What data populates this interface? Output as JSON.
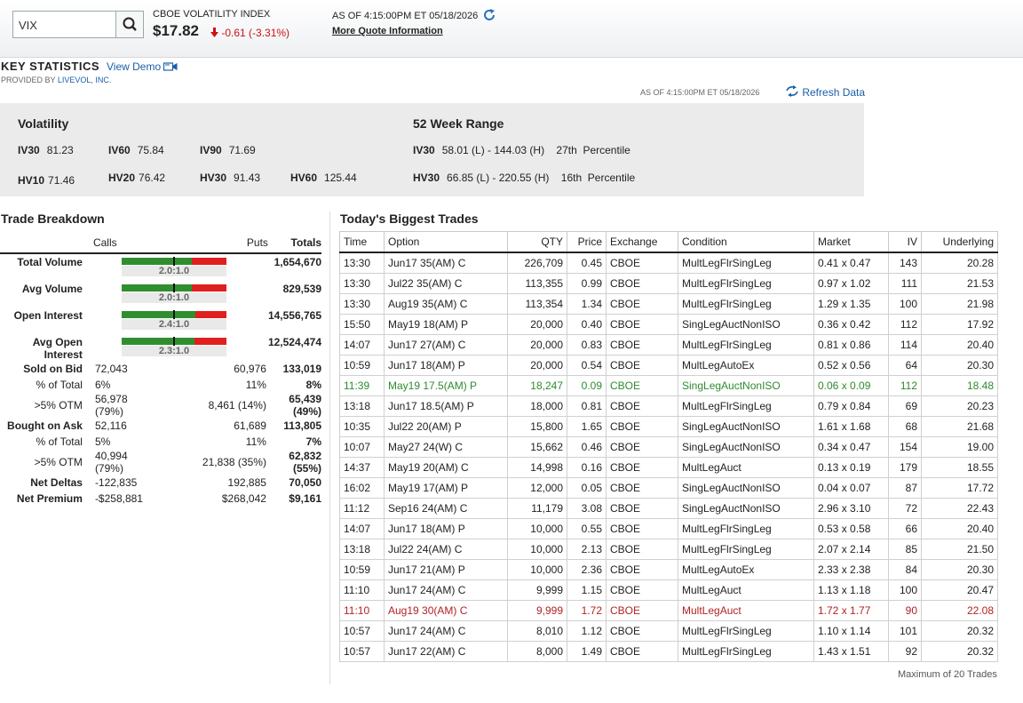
{
  "quote": {
    "symbol_value": "VIX",
    "name": "CBOE VOLATILITY INDEX",
    "price": "$17.82",
    "change": "-0.61 (-3.31%)",
    "asof": "AS OF 4:15:00PM ET 05/18/2026",
    "more_info": "More Quote Information"
  },
  "key_stats": {
    "title": "KEY STATISTICS",
    "view_demo": "View Demo",
    "provided_prefix": "PROVIDED BY",
    "provider": "LIVEVOL, INC.",
    "asof": "AS OF 4:15:00PM ET 05/18/2026",
    "refresh_label": "Refresh Data"
  },
  "volatility": {
    "title": "Volatility",
    "items": [
      {
        "label": "IV30",
        "value": "81.23"
      },
      {
        "label": "IV60",
        "value": "75.84"
      },
      {
        "label": "IV90",
        "value": "71.69"
      },
      {
        "label": "HV10",
        "value": "71.46"
      },
      {
        "label": "HV20",
        "value": "76.42"
      },
      {
        "label": "HV30",
        "value": "91.43"
      },
      {
        "label": "HV60",
        "value": "125.44"
      }
    ]
  },
  "week52": {
    "title": "52 Week Range",
    "rows": [
      {
        "label": "IV30",
        "range": "58.01 (L) - 144.03 (H)",
        "pct": "27th",
        "pct_label": "Percentile"
      },
      {
        "label": "HV30",
        "range": "66.85 (L) - 220.55 (H)",
        "pct": "16th",
        "pct_label": "Percentile"
      }
    ]
  },
  "trade_breakdown": {
    "title": "Trade Breakdown",
    "headers": {
      "calls": "Calls",
      "puts": "Puts",
      "totals": "Totals"
    },
    "ratio_rows": [
      {
        "label": "Total Volume",
        "ratio": "2.0:1.0",
        "call_fraction": 0.667,
        "total": "1,654,670"
      },
      {
        "label": "Avg Volume",
        "ratio": "2.0:1.0",
        "call_fraction": 0.667,
        "total": "829,539"
      },
      {
        "label": "Open Interest",
        "ratio": "2.4:1.0",
        "call_fraction": 0.706,
        "total": "14,556,765"
      },
      {
        "label": "Avg Open Interest",
        "ratio": "2.3:1.0",
        "call_fraction": 0.697,
        "total": "12,524,474"
      }
    ],
    "rows": [
      {
        "label": "Sold on Bid",
        "calls": "72,043",
        "puts": "60,976",
        "total": "133,019",
        "bold": true
      },
      {
        "label": "% of Total",
        "calls": "6%",
        "puts": "11%",
        "total": "8%",
        "bold": false
      },
      {
        "label": ">5% OTM",
        "calls": "56,978 (79%)",
        "puts": "8,461 (14%)",
        "total": "65,439 (49%)",
        "bold": false
      },
      {
        "label": "Bought on Ask",
        "calls": "52,116",
        "puts": "61,689",
        "total": "113,805",
        "bold": true
      },
      {
        "label": "% of Total",
        "calls": "5%",
        "puts": "11%",
        "total": "7%",
        "bold": false
      },
      {
        "label": ">5% OTM",
        "calls": "40,994 (79%)",
        "puts": "21,838 (35%)",
        "total": "62,832 (55%)",
        "bold": false
      },
      {
        "label": "Net Deltas",
        "calls": "-122,835",
        "puts": "192,885",
        "total": "70,050",
        "bold": true
      },
      {
        "label": "Net Premium",
        "calls": "-$258,881",
        "puts": "$268,042",
        "total": "$9,161",
        "bold": true
      }
    ]
  },
  "biggest_trades": {
    "title": "Today's Biggest Trades",
    "headers": [
      "Time",
      "Option",
      "QTY",
      "Price",
      "Exchange",
      "Condition",
      "Market",
      "IV",
      "Underlying"
    ],
    "rows": [
      [
        "13:30",
        "Jun17 35(AM) C",
        "226,709",
        "0.45",
        "CBOE",
        "MultLegFlrSingLeg",
        "0.41 x 0.47",
        "143",
        "20.28",
        ""
      ],
      [
        "13:30",
        "Jul22 35(AM) C",
        "113,355",
        "0.99",
        "CBOE",
        "MultLegFlrSingLeg",
        "0.97 x 1.02",
        "111",
        "21.53",
        ""
      ],
      [
        "13:30",
        "Aug19 35(AM) C",
        "113,354",
        "1.34",
        "CBOE",
        "MultLegFlrSingLeg",
        "1.29 x 1.35",
        "100",
        "21.98",
        ""
      ],
      [
        "15:50",
        "May19 18(AM) P",
        "20,000",
        "0.40",
        "CBOE",
        "SingLegAuctNonISO",
        "0.36 x 0.42",
        "112",
        "17.92",
        ""
      ],
      [
        "14:07",
        "Jun17 27(AM) C",
        "20,000",
        "0.83",
        "CBOE",
        "MultLegFlrSingLeg",
        "0.81 x 0.86",
        "114",
        "20.40",
        ""
      ],
      [
        "10:59",
        "Jun17 18(AM) P",
        "20,000",
        "0.54",
        "CBOE",
        "MultLegAutoEx",
        "0.52 x 0.56",
        "64",
        "20.30",
        ""
      ],
      [
        "11:39",
        "May19 17.5(AM) P",
        "18,247",
        "0.09",
        "CBOE",
        "SingLegAuctNonISO",
        "0.06 x 0.09",
        "112",
        "18.48",
        "#2e8b2e"
      ],
      [
        "13:18",
        "Jun17 18.5(AM) P",
        "18,000",
        "0.81",
        "CBOE",
        "MultLegFlrSingLeg",
        "0.79 x 0.84",
        "69",
        "20.23",
        ""
      ],
      [
        "10:35",
        "Jul22 20(AM) P",
        "15,800",
        "1.65",
        "CBOE",
        "SingLegAuctNonISO",
        "1.61 x 1.68",
        "68",
        "21.68",
        ""
      ],
      [
        "10:07",
        "May27 24(W) C",
        "15,662",
        "0.46",
        "CBOE",
        "SingLegAuctNonISO",
        "0.34 x 0.47",
        "154",
        "19.00",
        ""
      ],
      [
        "14:37",
        "May19 20(AM) C",
        "14,998",
        "0.16",
        "CBOE",
        "MultLegAuct",
        "0.13 x 0.19",
        "179",
        "18.55",
        ""
      ],
      [
        "16:02",
        "May19 17(AM) P",
        "12,000",
        "0.05",
        "CBOE",
        "SingLegAuctNonISO",
        "0.04 x 0.07",
        "87",
        "17.72",
        ""
      ],
      [
        "11:12",
        "Sep16 24(AM) C",
        "11,179",
        "3.08",
        "CBOE",
        "SingLegAuctNonISO",
        "2.96 x 3.10",
        "72",
        "22.43",
        ""
      ],
      [
        "14:07",
        "Jun17 18(AM) P",
        "10,000",
        "0.55",
        "CBOE",
        "MultLegFlrSingLeg",
        "0.53 x 0.58",
        "66",
        "20.40",
        ""
      ],
      [
        "13:18",
        "Jul22 24(AM) C",
        "10,000",
        "2.13",
        "CBOE",
        "MultLegFlrSingLeg",
        "2.07 x 2.14",
        "85",
        "21.50",
        ""
      ],
      [
        "10:59",
        "Jun17 21(AM) P",
        "10,000",
        "2.36",
        "CBOE",
        "MultLegAutoEx",
        "2.33 x 2.38",
        "84",
        "20.30",
        ""
      ],
      [
        "11:10",
        "Jun17 24(AM) C",
        "9,999",
        "1.15",
        "CBOE",
        "MultLegAuct",
        "1.13 x 1.18",
        "100",
        "20.47",
        ""
      ],
      [
        "11:10",
        "Aug19 30(AM) C",
        "9,999",
        "1.72",
        "CBOE",
        "MultLegAuct",
        "1.72 x 1.77",
        "90",
        "22.08",
        "#b22222"
      ],
      [
        "10:57",
        "Jun17 24(AM) C",
        "8,010",
        "1.12",
        "CBOE",
        "MultLegFlrSingLeg",
        "1.10 x 1.14",
        "101",
        "20.32",
        ""
      ],
      [
        "10:57",
        "Jun17 22(AM) C",
        "8,000",
        "1.49",
        "CBOE",
        "MultLegFlrSingLeg",
        "1.43 x 1.51",
        "92",
        "20.32",
        ""
      ]
    ],
    "footer_note": "Maximum of 20 Trades"
  },
  "colors": {
    "calls_bar": "#2f8f2f",
    "puts_bar": "#e01f1f",
    "link": "#1a5fa8",
    "down": "#cc1111"
  }
}
